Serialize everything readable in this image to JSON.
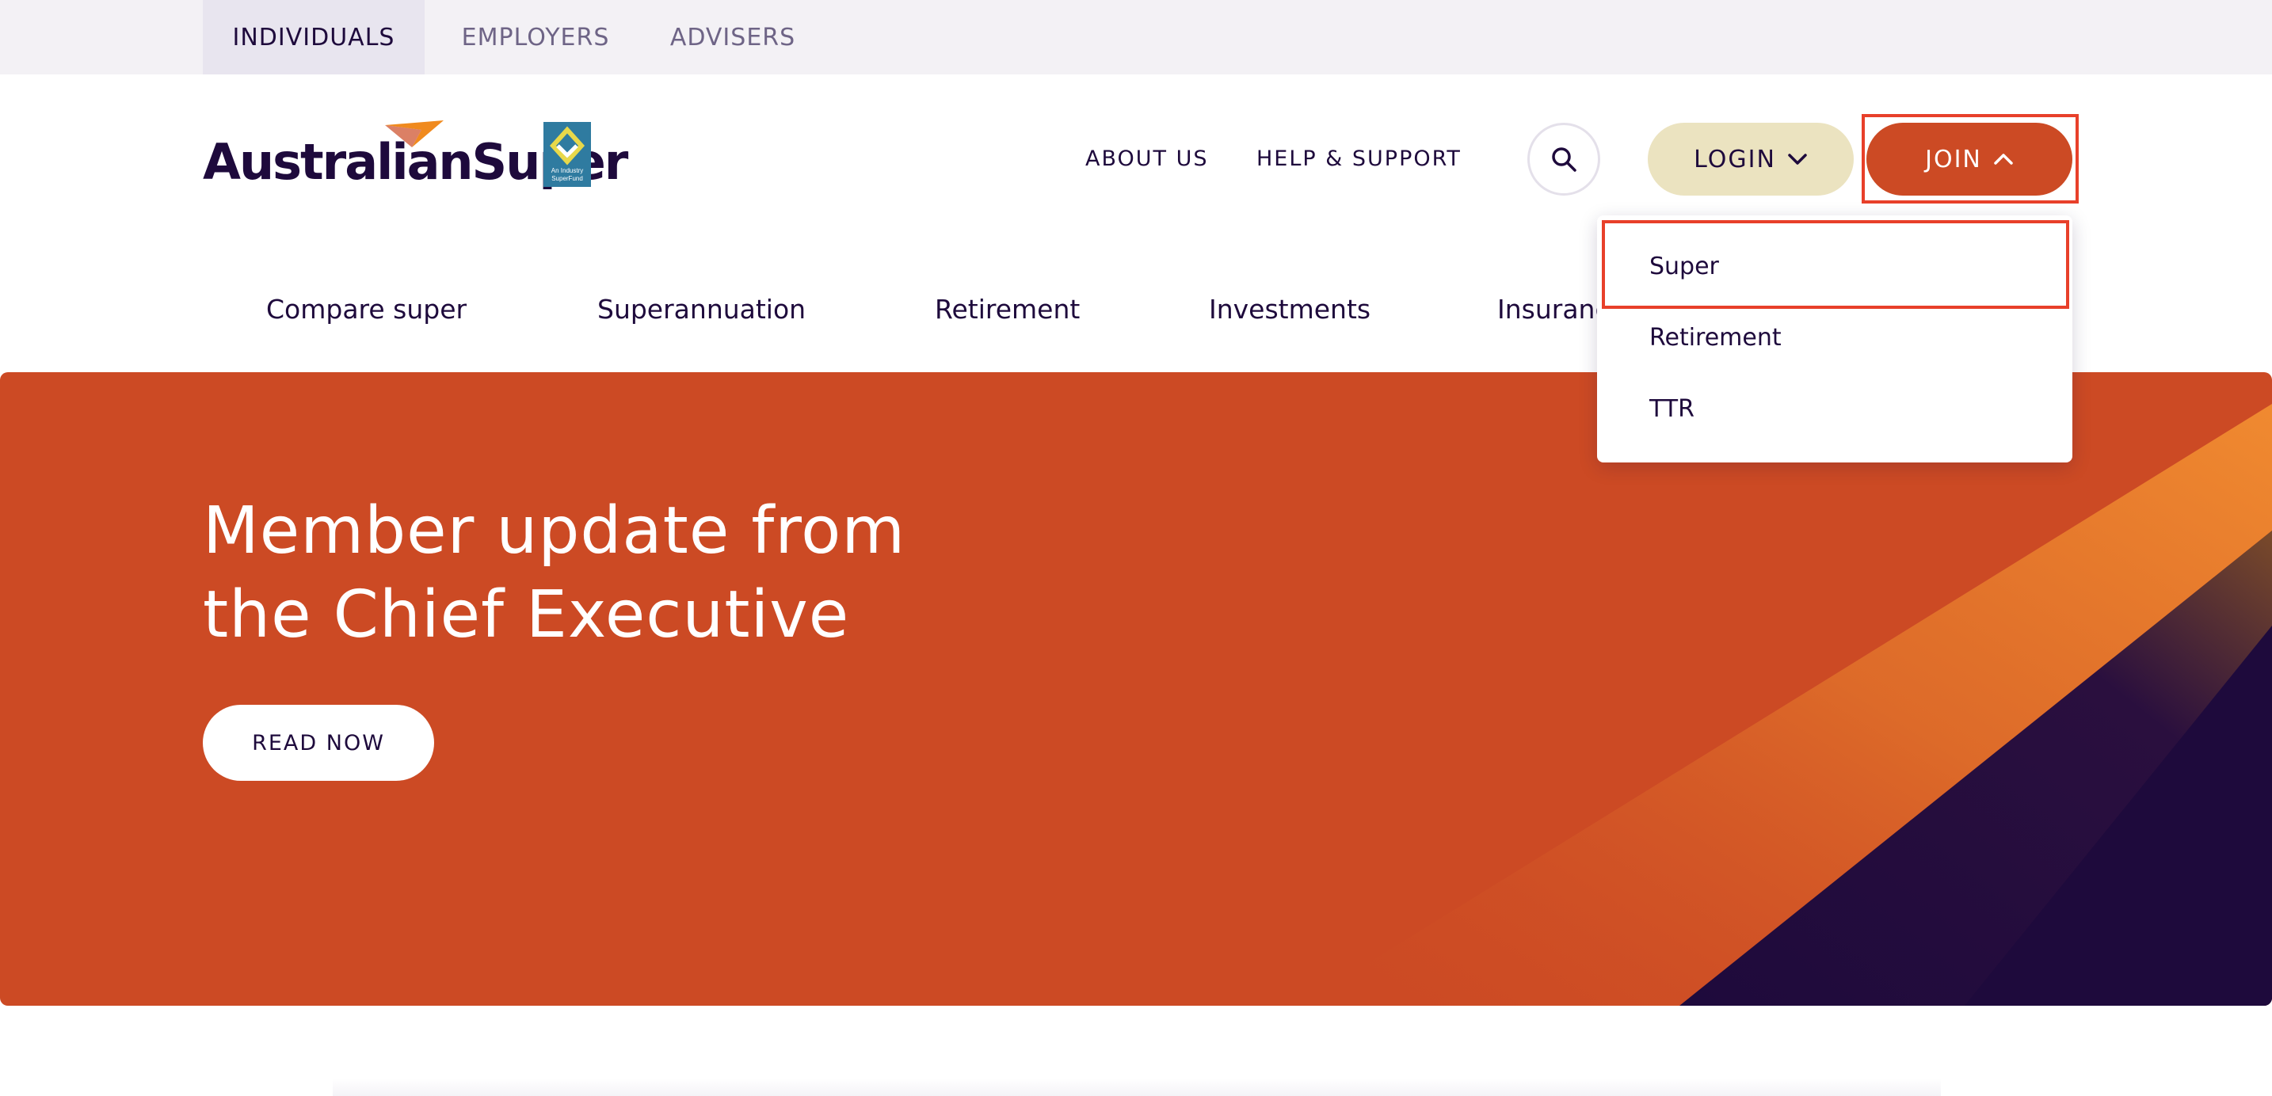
{
  "audience_tabs": [
    {
      "label": "INDIVIDUALS",
      "active": true
    },
    {
      "label": "EMPLOYERS",
      "active": false
    },
    {
      "label": "ADVISERS",
      "active": false
    }
  ],
  "header": {
    "logo_text": "AustralianSuper",
    "badge_text_line1": "An Industry",
    "badge_text_line2": "SuperFund",
    "about_label": "ABOUT US",
    "help_label": "HELP & SUPPORT",
    "search_icon": "search-icon",
    "login_label": "LOGIN",
    "join_label": "JOIN"
  },
  "main_nav": [
    {
      "label": "Compare super"
    },
    {
      "label": "Superannuation"
    },
    {
      "label": "Retirement"
    },
    {
      "label": "Investments"
    },
    {
      "label": "Insurance"
    }
  ],
  "join_dropdown": {
    "items": [
      {
        "label": "Super",
        "highlighted": true
      },
      {
        "label": "Retirement",
        "highlighted": false
      },
      {
        "label": "TTR",
        "highlighted": false
      }
    ]
  },
  "hero": {
    "title_line1": "Member update from",
    "title_line2": "the Chief Executive",
    "cta_label": "READ NOW"
  },
  "colors": {
    "brand_orange": "#cc4a24",
    "brand_navy": "#1e0a3c",
    "login_bg": "#ebe3c0",
    "highlight": "#e8402a"
  }
}
